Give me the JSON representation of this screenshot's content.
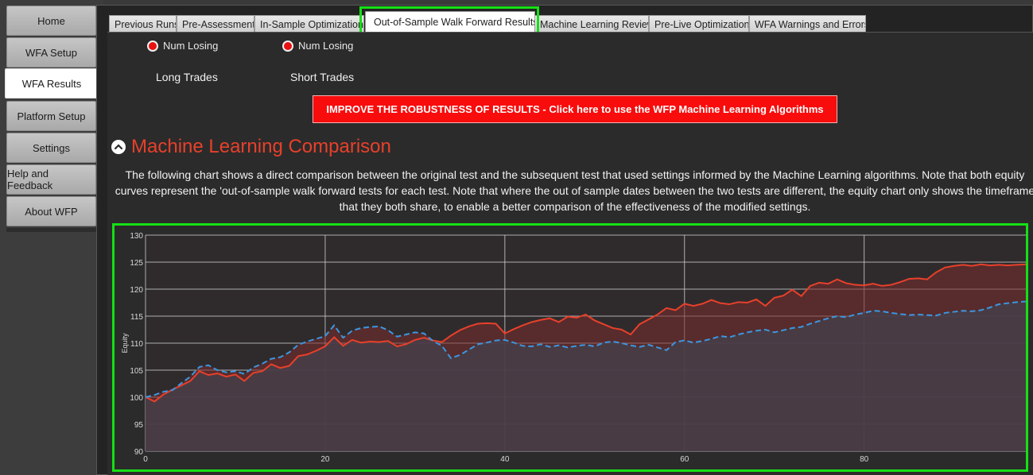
{
  "sidebar": {
    "items": [
      {
        "label": "Home"
      },
      {
        "label": "WFA Setup"
      },
      {
        "label": "WFA Results"
      },
      {
        "label": "Platform Setup"
      },
      {
        "label": "Settings"
      },
      {
        "label": "Help and Feedback"
      },
      {
        "label": "About WFP"
      }
    ],
    "active": "WFA Results"
  },
  "tabs": [
    {
      "label": "Previous Runs"
    },
    {
      "label": "Pre-Assessment"
    },
    {
      "label": "In-Sample Optimization"
    },
    {
      "label": "Out-of-Sample Walk Forward Results"
    },
    {
      "label": "Machine Learning Review"
    },
    {
      "label": "Pre-Live Optimization"
    },
    {
      "label": "WFA Warnings and Errors"
    }
  ],
  "active_tab": "Out-of-Sample Walk Forward Results",
  "options": {
    "long_num_losing": "Num Losing",
    "short_num_losing": "Num Losing",
    "long_trades": "Long Trades",
    "short_trades": "Short Trades"
  },
  "cta_button": "IMPROVE THE ROBUSTNESS OF RESULTS - Click here to use the WFP Machine Learning Algorithms",
  "section": {
    "title": "Machine Learning Comparison",
    "description": "The following chart shows a direct comparison between the original test and the subsequent test that used settings informed by the Machine Learning algorithms. Note that both equity curves represent the 'out-of-sample walk forward tests for each test. Note that where the out of sample dates between the two tests are different, the equity chart only shows the timeframe that they both share, to enable a better comparison of the effectiveness of the modified settings."
  },
  "colors": {
    "accent_red": "#e8402a",
    "highlight_green": "#16e016",
    "series_red": "#e8402a",
    "series_blue": "#3c96e0"
  },
  "icons": {
    "collapse": "chevron-up-icon"
  },
  "chart_data": {
    "type": "area",
    "title": "",
    "xlabel": "",
    "ylabel": "Equity",
    "xlim": [
      0,
      98
    ],
    "ylim": [
      90,
      130
    ],
    "xticks": [
      0,
      20,
      40,
      60,
      80
    ],
    "yticks": [
      90,
      95,
      100,
      105,
      110,
      115,
      120,
      125,
      130
    ],
    "grid": true,
    "series": [
      {
        "color": "#e8402a",
        "style": "solid",
        "x": [
          0,
          1,
          2,
          3,
          4,
          5,
          6,
          7,
          8,
          9,
          10,
          11,
          12,
          13,
          14,
          15,
          16,
          17,
          18,
          19,
          20,
          21,
          22,
          23,
          24,
          25,
          26,
          27,
          28,
          29,
          30,
          31,
          32,
          33,
          34,
          35,
          36,
          37,
          38,
          39,
          40,
          41,
          42,
          43,
          44,
          45,
          46,
          47,
          48,
          49,
          50,
          51,
          52,
          53,
          54,
          55,
          56,
          57,
          58,
          59,
          60,
          61,
          62,
          63,
          64,
          65,
          66,
          67,
          68,
          69,
          70,
          71,
          72,
          73,
          74,
          75,
          76,
          77,
          78,
          79,
          80,
          81,
          82,
          83,
          84,
          85,
          86,
          87,
          88,
          89,
          90,
          91,
          92,
          93,
          94,
          95,
          96,
          97,
          98
        ],
        "values": [
          100,
          99.2,
          100.5,
          101.4,
          102.2,
          103.0,
          104.8,
          104.1,
          104.4,
          103.8,
          104.2,
          103.0,
          104.5,
          104.8,
          106.1,
          105.4,
          105.8,
          107.6,
          107.9,
          108.6,
          109.4,
          111.1,
          109.5,
          110.6,
          110.1,
          110.3,
          110.2,
          110.4,
          109.4,
          109.8,
          110.6,
          111.0,
          110.5,
          110.2,
          111.4,
          112.4,
          113.1,
          113.6,
          113.7,
          113.6,
          111.8,
          112.6,
          113.3,
          113.9,
          114.3,
          114.6,
          113.9,
          114.9,
          114.7,
          115.3,
          114.2,
          113.5,
          112.8,
          112.5,
          111.6,
          113.5,
          114.4,
          115.3,
          116.5,
          116.1,
          117.3,
          116.9,
          117.3,
          118.0,
          117.4,
          117.2,
          117.6,
          117.5,
          118.1,
          116.9,
          118.4,
          118.8,
          119.9,
          118.7,
          120.6,
          121.2,
          121.0,
          121.8,
          121.1,
          120.8,
          120.7,
          121.0,
          120.6,
          120.8,
          121.3,
          121.9,
          122.0,
          121.8,
          123.1,
          124.0,
          124.3,
          124.5,
          124.3,
          124.6,
          124.4,
          124.5,
          124.4,
          124.5,
          124.6
        ]
      },
      {
        "color": "#3c96e0",
        "style": "dashed",
        "x": [
          0,
          1,
          2,
          3,
          4,
          5,
          6,
          7,
          8,
          9,
          10,
          11,
          12,
          13,
          14,
          15,
          16,
          17,
          18,
          19,
          20,
          21,
          22,
          23,
          24,
          25,
          26,
          27,
          28,
          29,
          30,
          31,
          32,
          33,
          34,
          35,
          36,
          37,
          38,
          39,
          40,
          41,
          42,
          43,
          44,
          45,
          46,
          47,
          48,
          49,
          50,
          51,
          52,
          53,
          54,
          55,
          56,
          57,
          58,
          59,
          60,
          61,
          62,
          63,
          64,
          65,
          66,
          67,
          68,
          69,
          70,
          71,
          72,
          73,
          74,
          75,
          76,
          77,
          78,
          79,
          80,
          81,
          82,
          83,
          84,
          85,
          86,
          87,
          88,
          89,
          90,
          91,
          92,
          93,
          94,
          95,
          96,
          97,
          98
        ],
        "values": [
          100,
          100.4,
          101.0,
          101.3,
          102.6,
          103.8,
          105.6,
          105.9,
          105.0,
          104.6,
          104.8,
          104.3,
          105.5,
          106.2,
          107.1,
          107.4,
          108.3,
          109.7,
          110.3,
          110.8,
          111.3,
          113.3,
          111.0,
          112.3,
          112.8,
          113.0,
          113.1,
          112.4,
          111.2,
          111.6,
          112.0,
          111.8,
          110.4,
          109.5,
          107.2,
          107.8,
          108.8,
          109.8,
          110.1,
          110.5,
          110.6,
          110.1,
          109.5,
          109.4,
          109.8,
          109.3,
          109.6,
          109.2,
          109.5,
          109.7,
          109.4,
          110.1,
          110.3,
          110.0,
          109.6,
          109.3,
          109.7,
          109.2,
          108.7,
          110.2,
          110.5,
          110.1,
          110.4,
          110.8,
          111.3,
          111.1,
          111.6,
          112.0,
          112.3,
          112.5,
          112.0,
          112.4,
          112.8,
          113.0,
          113.6,
          114.1,
          114.6,
          115.0,
          114.8,
          115.3,
          115.6,
          116.0,
          115.9,
          115.6,
          115.4,
          115.2,
          115.3,
          115.2,
          115.1,
          115.6,
          115.8,
          116.0,
          115.9,
          116.1,
          116.6,
          117.2,
          117.4,
          117.6,
          117.7
        ]
      }
    ]
  }
}
